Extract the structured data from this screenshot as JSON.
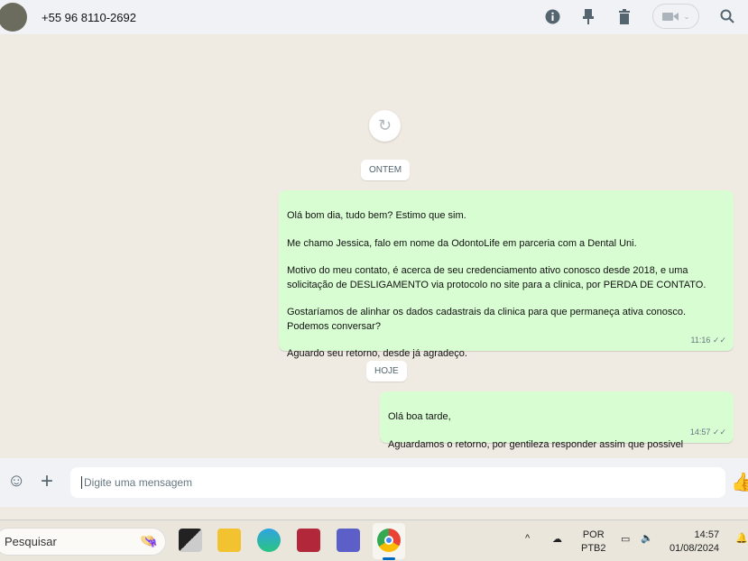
{
  "header": {
    "contact": "+55 96 8110-2692",
    "icons": [
      "info-icon",
      "pin-icon",
      "trash-icon",
      "video-call-icon",
      "search-icon"
    ]
  },
  "chat": {
    "dates": [
      "ONTEM",
      "HOJE"
    ],
    "messages": [
      {
        "text": "Olá bom dia, tudo bem? Estimo que sim.\n\nMe chamo Jessica, falo em nome da OdontoLife em parceria com a Dental Uni.\n\nMotivo do meu contato, é acerca de seu credenciamento ativo conosco desde 2018, e uma\nsolicitação de DESLIGAMENTO via protocolo no site para a clinica, por PERDA DE CONTATO.\n\nGostaríamos de alinhar os dados cadastrais da clinica para que permaneça ativa conosco.\nPodemos conversar?\n\nAguardo seu retorno, desde já agradeço.",
        "time": "11:16"
      },
      {
        "text": "Olá boa tarde,\n\nAguardamos o retorno, por gentileza responder assim que possivel",
        "time": "14:57"
      }
    ]
  },
  "composer": {
    "placeholder": "Digite uma mensagem"
  },
  "taskbar": {
    "search": "Pesquisar",
    "lang1": "POR",
    "lang2": "PTB2",
    "time": "14:57",
    "date": "01/08/2024"
  }
}
